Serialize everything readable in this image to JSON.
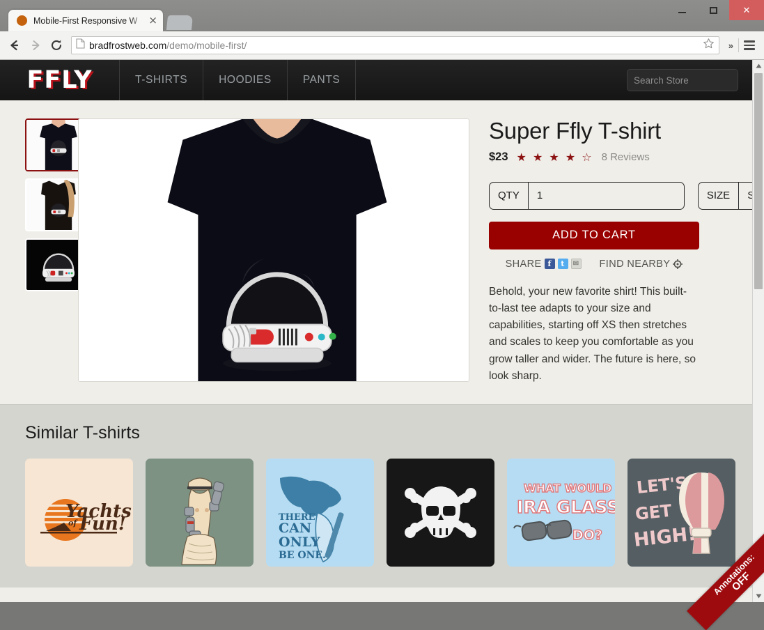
{
  "browser": {
    "tab_title": "Mobile-First Responsive W",
    "tab_close": "×",
    "url_domain": "bradfrostweb.com",
    "url_path": "/demo/mobile-first/",
    "overflow_chevron": "»",
    "minimize": "—",
    "maximize": "□",
    "close": "✕"
  },
  "site": {
    "logo": "FFLY",
    "nav": [
      {
        "label": "T-SHIRTS"
      },
      {
        "label": "HOODIES"
      },
      {
        "label": "PANTS"
      }
    ],
    "search": {
      "placeholder": "Search Store",
      "value": ""
    }
  },
  "product": {
    "title": "Super Ffly T-shirt",
    "price": "$23",
    "stars": "★ ★ ★ ★ ☆",
    "rating_value": 4,
    "rating_max": 5,
    "reviews": "8 Reviews",
    "qty_label": "QTY",
    "qty_value": "1",
    "size_label": "SIZE",
    "size_value": "S",
    "add_to_cart": "ADD TO CART",
    "share_label": "SHARE",
    "share_facebook": "f",
    "share_twitter": "t",
    "share_email": "✉",
    "find_nearby": "FIND NEARBY",
    "description": "Behold, your new favorite shirt! This built-to-last tee adapts to your size and capabilities, starting off XS then stretches and scales to keep you comfortable as you grow taller and wider. The future is here, so look sharp.",
    "thumbnails": [
      {
        "name": "mens-black-tee",
        "selected": true
      },
      {
        "name": "womens-black-tee",
        "selected": false
      },
      {
        "name": "helmet-graphic-closeup",
        "selected": false
      }
    ]
  },
  "similar": {
    "heading": "Similar T-shirts",
    "items": [
      {
        "name": "yachts-of-fun",
        "line1": "Yachts",
        "line2": "of",
        "line3": "Fun!",
        "bg": "#f6e6d3",
        "fg": "#4a2a16",
        "accent": "#e8761e"
      },
      {
        "name": "venus-robot-arms",
        "line1": "",
        "bg": "#7d9283",
        "fg": "#f0ddbe",
        "accent": "#9aa0a6"
      },
      {
        "name": "there-can-only-be-one",
        "line1": "THERE",
        "line2": "CAN",
        "line3": "ONLY",
        "line4": "BE ONE.",
        "bg": "#b5dcf2",
        "fg": "#2b6b93",
        "accent": "#3d7fa6"
      },
      {
        "name": "skull-and-crossbones",
        "line1": "",
        "bg": "#171717",
        "fg": "#f2f2f2",
        "accent": "#ffffff"
      },
      {
        "name": "what-would-ira-glass-do",
        "line1": "WHAT WOULD",
        "line2": "IRA GLASS",
        "line3": "DO?",
        "bg": "#b5dcf2",
        "fg": "#ffffff",
        "accent": "#e0787c"
      },
      {
        "name": "lets-get-high",
        "line1": "LET'S",
        "line2": "GET",
        "line3": "HIGH!",
        "bg": "#555f63",
        "fg": "#f0c9cb",
        "accent": "#f5ece0"
      }
    ]
  },
  "overlay": {
    "ribbon_line1": "Annotations:",
    "ribbon_line2": "OFF",
    "ribbon_color": "#9e0b0e"
  }
}
